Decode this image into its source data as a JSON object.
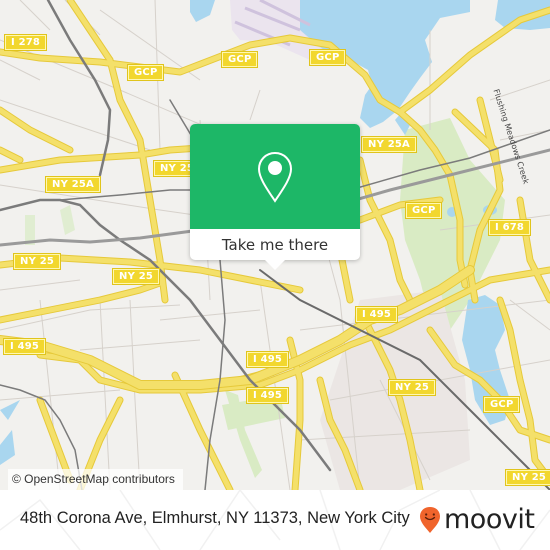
{
  "map": {
    "colors": {
      "land": "#f2f1ee",
      "water": "#a9d6ef",
      "park": "#d9ebc4",
      "highway": "#f4e06a",
      "highway_edge": "#e6c93a",
      "rail": "#7b7b7b",
      "minor_road": "#cfcac4",
      "airport": "#e8e1ee"
    },
    "shields": [
      {
        "label": "I 278"
      },
      {
        "label": "GCP"
      },
      {
        "label": "GCP"
      },
      {
        "label": "GCP"
      },
      {
        "label": "NY 25A"
      },
      {
        "label": "NY 25A"
      },
      {
        "label": "NY 25"
      },
      {
        "label": "NY 25"
      },
      {
        "label": "NY 25"
      },
      {
        "label": "GCP"
      },
      {
        "label": "I 678"
      },
      {
        "label": "I 495"
      },
      {
        "label": "I 495"
      },
      {
        "label": "I 495"
      },
      {
        "label": "I 495"
      },
      {
        "label": "NY 25"
      },
      {
        "label": "GCP"
      },
      {
        "label": "NY 25"
      }
    ],
    "street_labels": [
      {
        "label": "Flushing Meadows Creek"
      }
    ],
    "attribution": "© OpenStreetMap contributors"
  },
  "popup": {
    "icon": "map-pin-icon",
    "action_label": "Take me there",
    "accent_color": "#1db767"
  },
  "footer": {
    "address": "48th Corona Ave, Elmhurst, NY 11373, New York City",
    "brand_name": "moovit",
    "brand_icon": "moovit-pin-icon",
    "brand_color": "#f0642c"
  }
}
